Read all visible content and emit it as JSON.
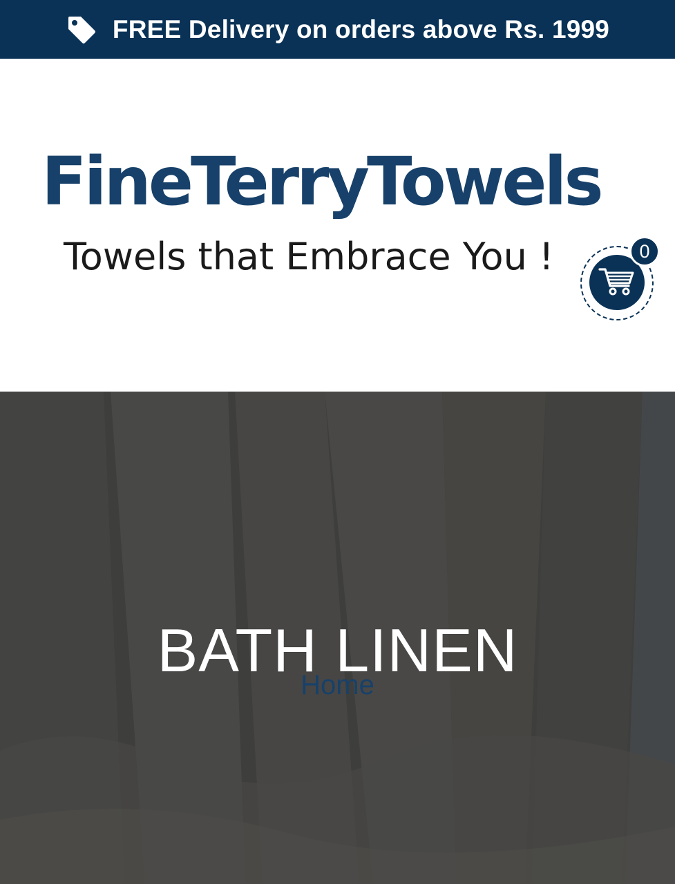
{
  "announcement": {
    "icon": "tag-icon",
    "text": "FREE Delivery on orders above Rs. 1999"
  },
  "header": {
    "logo": {
      "wordmark": "FineTerryTowels",
      "tagline": "Towels that Embrace You !"
    },
    "cart": {
      "icon": "shopping-cart-icon",
      "count": "0"
    }
  },
  "hero": {
    "title": "BATH LINEN",
    "breadcrumb": "Home"
  },
  "colors": {
    "brand_navy": "#0a3256",
    "logo_blue": "#17416a",
    "hero_overlay": "#4b4b4a"
  }
}
